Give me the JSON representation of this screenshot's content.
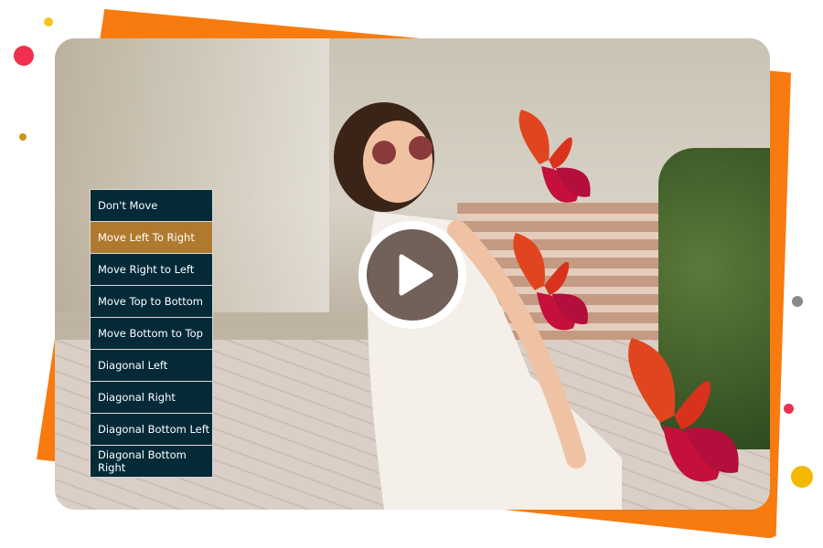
{
  "menu": {
    "items": [
      {
        "label": "Don't Move",
        "selected": false
      },
      {
        "label": "Move Left To Right",
        "selected": true
      },
      {
        "label": "Move Right to Left",
        "selected": false
      },
      {
        "label": "Move Top to Bottom",
        "selected": false
      },
      {
        "label": "Move Bottom to Top",
        "selected": false
      },
      {
        "label": "Diagonal Left",
        "selected": false
      },
      {
        "label": "Diagonal Right",
        "selected": false
      },
      {
        "label": "Diagonal Bottom Left",
        "selected": false
      },
      {
        "label": "Diagonal Bottom Right",
        "selected": false
      }
    ]
  },
  "colors": {
    "accent": "#f77b0f",
    "menu_bg": "#042a38",
    "menu_selected": "#b07a2e"
  },
  "icons": {
    "play": "play-icon",
    "butterfly": "butterfly-icon"
  }
}
